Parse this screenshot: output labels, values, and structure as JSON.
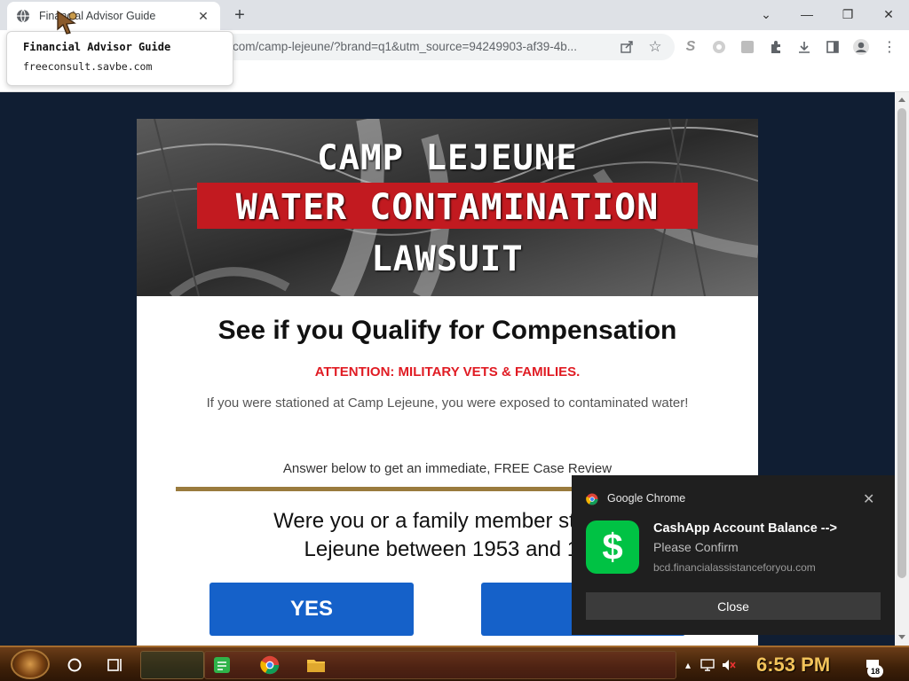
{
  "browser": {
    "tab_title": "Financial Advisor Guide",
    "url": "com/camp-lejeune/?brand=q1&utm_source=94249903-af39-4b...",
    "hovercard": {
      "title": "Financial Advisor Guide",
      "url": "freeconsult.savbe.com"
    }
  },
  "page": {
    "hero": {
      "line1": "CAMP LEJEUNE",
      "line2": "WATER CONTAMINATION",
      "line3": "LAWSUIT"
    },
    "headline": "See if you Qualify for Compensation",
    "attention": "ATTENTION: MILITARY VETS & FAMILIES.",
    "subtext": "If you were stationed at Camp Lejeune, you were exposed to contaminated water!",
    "answer_prompt": "Answer below to get an immediate, FREE Case Review",
    "question_line1": "Were you or a family member station",
    "question_line2": "Lejeune between 1953 and 19",
    "yes_label": "YES",
    "no_label": "N"
  },
  "notification": {
    "app": "Google Chrome",
    "title": "CashApp Account Balance -->",
    "body": "Please Confirm",
    "source": "bcd.financialassistanceforyou.com",
    "button": "Close",
    "app_icon_glyph": "$"
  },
  "taskbar": {
    "time": "6:53 PM",
    "notification_count": "18"
  },
  "colors": {
    "hero_red": "#c21a20",
    "attention_red": "#e01b23",
    "button_blue": "#1561c9",
    "divider_gold": "#9a7b3e",
    "cashapp_green": "#00c244",
    "clock_gold": "#f2c35a"
  }
}
